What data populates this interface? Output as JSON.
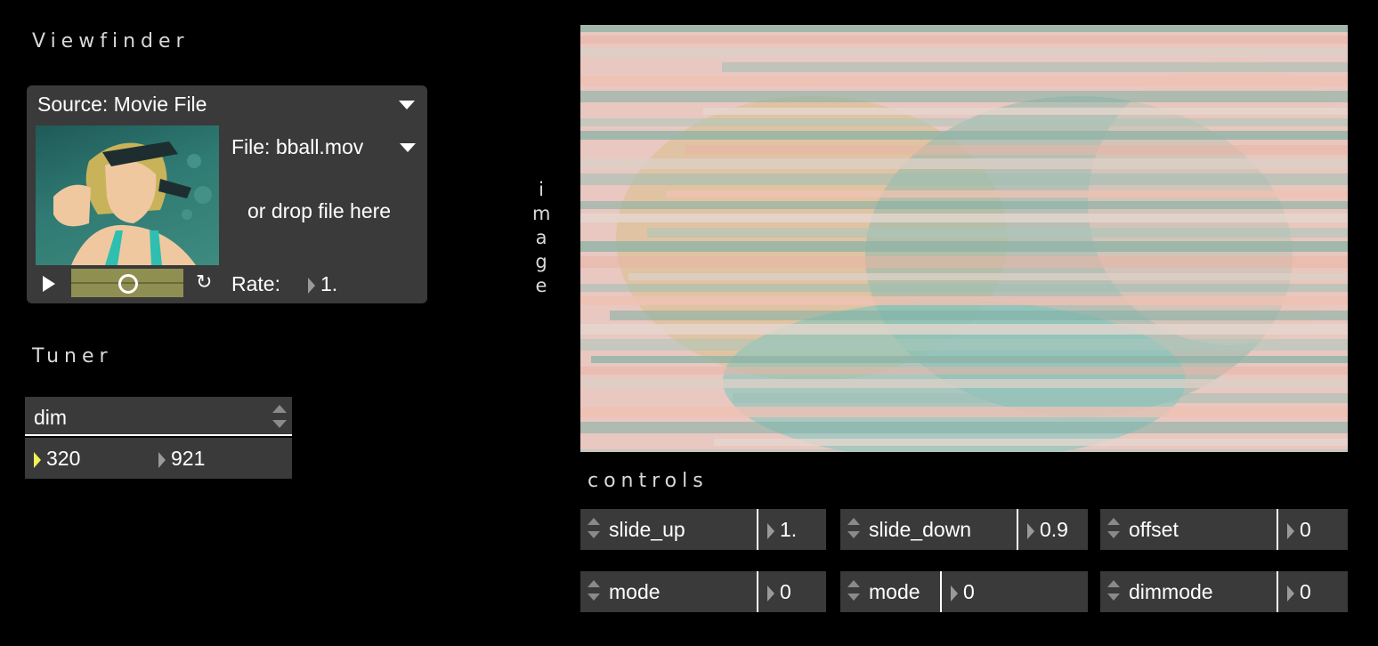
{
  "viewfinder": {
    "title": "Viewfinder",
    "source_label": "Source: Movie File",
    "file_label": "File:  bball.mov",
    "drop_text": "or drop file here",
    "rate_label": "Rate:",
    "rate_value": "1.",
    "playback_position": 0.5
  },
  "tuner": {
    "title": "Tuner",
    "selected": "dim",
    "values": [
      "320",
      "921"
    ]
  },
  "image_label": [
    "i",
    "m",
    "a",
    "g",
    "e"
  ],
  "controls": {
    "title": "controls",
    "row1": [
      {
        "name": "slide_up",
        "value": "1."
      },
      {
        "name": "slide_down",
        "value": "0.9"
      },
      {
        "name": "offset",
        "value": "0"
      }
    ],
    "row2": [
      {
        "name": "mode",
        "value": "0"
      },
      {
        "name": "mode",
        "value": "0"
      },
      {
        "name": "dimmode",
        "value": "0"
      }
    ]
  },
  "colors": {
    "panel_bg": "#3a3a3a",
    "slider_color": "#8f8f52",
    "active_triangle": "#f4f05a"
  }
}
